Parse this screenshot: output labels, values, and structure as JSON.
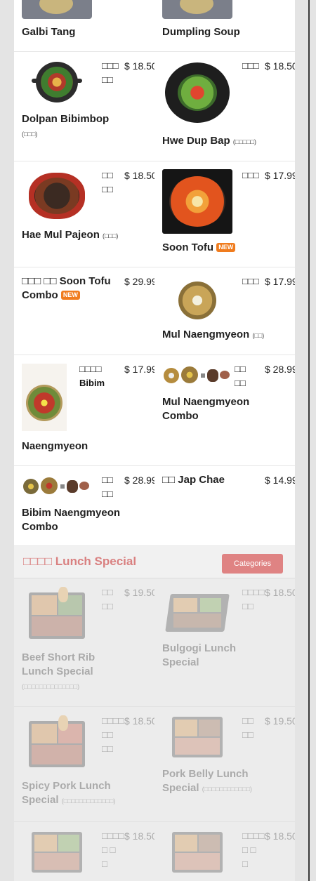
{
  "menu": {
    "top_row": [
      {
        "name": "Galbi Tang"
      },
      {
        "name": "Dumpling Soup"
      }
    ],
    "rows": [
      [
        {
          "name": "Dolpan Bibimbop",
          "kr_small": "(□□□)",
          "kor": "□□□ □□",
          "price": "$ 18.50"
        },
        {
          "name": "Hwe Dup Bap",
          "kr_small": "(□□□□□)",
          "kor": "□□□",
          "price": "$ 18.50"
        }
      ],
      [
        {
          "name": "Hae Mul Pajeon",
          "kr_small": "(□□□)",
          "kor": "□□ □□",
          "price": "$ 18.50"
        },
        {
          "name": "Soon Tofu",
          "badge": "NEW",
          "kor": "□□□",
          "price": "$ 17.99"
        }
      ],
      [
        {
          "name": "□□□ □□ Soon Tofu Combo",
          "badge": "NEW",
          "price": "$ 29.99"
        },
        {
          "name": "Mul Naengmyeon",
          "kr_small": "(□□)",
          "kor": "□□□",
          "price": "$ 17.99"
        }
      ],
      [
        {
          "name": "Naengmyeon",
          "kor": "□□□□ Bibim",
          "price": "$ 17.99"
        },
        {
          "name": "Mul Naengmyeon Combo",
          "kor": "□□ □□",
          "price": "$ 28.99"
        }
      ],
      [
        {
          "name": "Bibim Naengmyeon Combo",
          "kor": "□□ □□",
          "price": "$ 28.99"
        },
        {
          "name": "□□ Jap Chae",
          "price": "$ 14.99"
        }
      ]
    ]
  },
  "lunch": {
    "title": "□□□□ Lunch Special",
    "categories_label": "Categories",
    "items": [
      {
        "name": "Beef Short Rib Lunch Special",
        "kr_small": "(□□□□□□□□□□□□□□)",
        "kor": "□□ □□",
        "price": "$ 19.50"
      },
      {
        "name": "Bulgogi Lunch Special",
        "kor": "□□□□ □□",
        "price": "$ 18.50"
      },
      {
        "name": "Spicy Pork Lunch Special",
        "kr_small": "(□□□□□□□□□□□□□)",
        "kor": "□□□□ □□ □□",
        "price": "$ 18.50"
      },
      {
        "name": "Pork Belly Lunch Special",
        "kr_small": "(□□□□□□□□□□□□)",
        "kor": "□□ □□",
        "price": "$ 19.50"
      },
      {
        "kor": "□□□□ □ □ □",
        "price": "$ 18.50"
      },
      {
        "kor": "□□□□ □ □ □",
        "price": "$ 18.50"
      }
    ]
  },
  "colors": {
    "accent": "#df8383",
    "new_badge": "#f07c1e",
    "price_text": "#222222"
  }
}
